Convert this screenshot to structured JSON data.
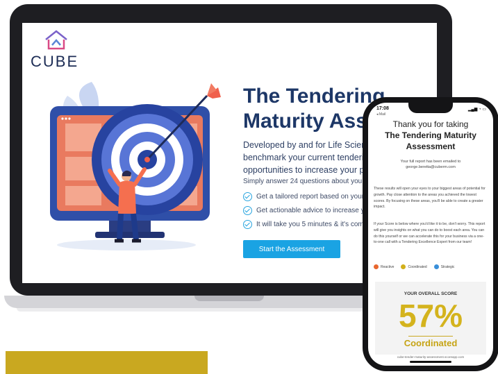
{
  "brand": {
    "name": "CUBE"
  },
  "landing": {
    "title_line1": "The Tendering",
    "title_line2": "Maturity Assessment",
    "description": "Developed by and for Life Sciences leaders to benchmark your current tendering/pricing and find opportunities to increase your performance.",
    "simply": "Simply answer 24 questions about your business",
    "benefits": [
      "Get a tailored report based on your answers",
      "Get actionable advice to increase your level",
      "It will take you 5 minutes & it's completely free"
    ],
    "cta": "Start the Assessment"
  },
  "phone": {
    "time": "17:08",
    "back": "◂ Mail",
    "status_icons": "▂▄▆ ◔ ▭",
    "thank_line": "Thank you for taking",
    "title_line1": "The Tendering Maturity",
    "title_line2": "Assessment",
    "email_note_1": "Your full report has been emailed to",
    "email_note_2": "george.beretta@cuberm.com",
    "paragraph1": "These results will open your eyes to your biggest areas of potential for growth. Pay close attention to the areas you achieved the lowest scores. By focusing on these areas, you'll be able to create a greater impact.",
    "paragraph2": "If your Score is below where you'd like it to be, don't worry. This report will give you insights on what you can do to boost each area. You can do this yourself or we can accelerate this for your business via a one-to-one call with a Tendering Excellence Expert from our team!",
    "legend": [
      {
        "label": "Reactive",
        "color": "#e8672f"
      },
      {
        "label": "Coordinated",
        "color": "#d2b01b"
      },
      {
        "label": "Strategic",
        "color": "#3a8fd9"
      }
    ],
    "score_heading": "YOUR OVERALL SCORE",
    "score_value": "57%",
    "score_level": "Coordinated",
    "url": "cube-tender-maturity-assessment.scoreapp.com"
  },
  "colors": {
    "navy": "#1d3767",
    "accent_blue": "#1aa3e3",
    "gold": "#c9a820",
    "target_red": "#f0604c"
  }
}
